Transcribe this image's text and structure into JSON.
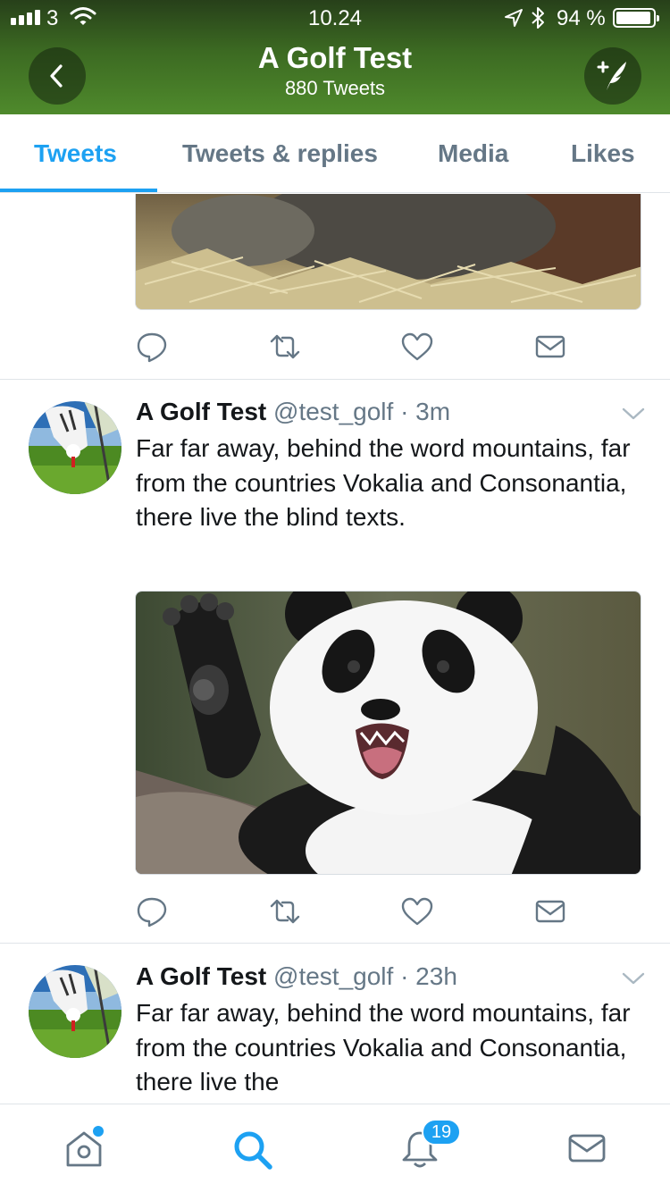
{
  "status_bar": {
    "carrier": "3",
    "time": "10.24",
    "battery": "94 %"
  },
  "header": {
    "title": "A Golf Test",
    "subtitle": "880 Tweets"
  },
  "tabs": [
    {
      "label": "Tweets",
      "active": true
    },
    {
      "label": "Tweets & replies",
      "active": false
    },
    {
      "label": "Media",
      "active": false
    },
    {
      "label": "Likes",
      "active": false
    }
  ],
  "tweets": [
    {
      "name": "A Golf Test",
      "handle": "@test_golf",
      "time": "· 3m",
      "text": "Far far away, behind the word mountains, far from the countries Vokalia and Consonantia, there live the blind texts.",
      "media": "panda-photo"
    },
    {
      "name": "A Golf Test",
      "handle": "@test_golf",
      "time": "· 23h",
      "text": "Far far away, behind the word mountains, far from the countries Vokalia and Consonantia, there live the"
    }
  ],
  "tab_bar": {
    "notifications_badge": "19"
  },
  "icons": [
    "back-icon",
    "compose-tweet-icon",
    "reply-icon",
    "retweet-icon",
    "like-icon",
    "direct-message-icon",
    "caret-down-icon",
    "home-icon",
    "search-icon",
    "notifications-icon",
    "messages-icon"
  ],
  "colors": {
    "accent": "#1da1f2",
    "secondary_text": "#657786",
    "primary_text": "#14171a"
  }
}
